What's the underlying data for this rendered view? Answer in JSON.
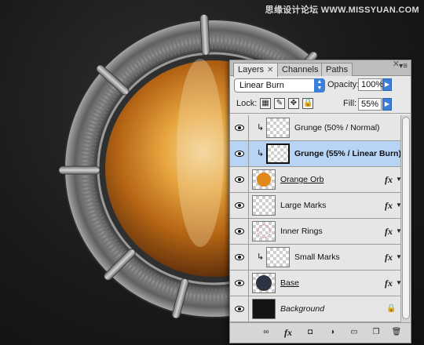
{
  "watermark": "思缘设计论坛 WWW.MISSYUAN.COM",
  "tabs": [
    {
      "label": "Layers",
      "active": true
    },
    {
      "label": "Channels",
      "active": false
    },
    {
      "label": "Paths",
      "active": false
    }
  ],
  "blend_mode": "Linear Burn",
  "opacity_label": "Opacity:",
  "opacity_value": "100%",
  "lock_label": "Lock:",
  "fill_label": "Fill:",
  "fill_value": "55%",
  "layers": [
    {
      "name": "Grunge (50% / Normal)",
      "clipped": true,
      "selected": false,
      "fx": false,
      "thumb": "transparent",
      "style": "normal"
    },
    {
      "name": "Grunge (55% / Linear Burn)",
      "clipped": true,
      "selected": true,
      "fx": false,
      "thumb": "transparent-selected",
      "style": "bold"
    },
    {
      "name": "Orange Orb",
      "clipped": false,
      "selected": false,
      "fx": true,
      "thumb": "orange-dot",
      "style": "underline"
    },
    {
      "name": "Large Marks",
      "clipped": false,
      "selected": false,
      "fx": true,
      "thumb": "transparent",
      "style": "normal"
    },
    {
      "name": "Inner Rings",
      "clipped": false,
      "selected": false,
      "fx": true,
      "thumb": "ring",
      "style": "normal"
    },
    {
      "name": "Small Marks",
      "clipped": true,
      "selected": false,
      "fx": true,
      "thumb": "transparent",
      "style": "normal"
    },
    {
      "name": "Base",
      "clipped": false,
      "selected": false,
      "fx": true,
      "thumb": "dark-disc",
      "style": "underline"
    },
    {
      "name": "Background",
      "clipped": false,
      "selected": false,
      "fx": false,
      "locked": true,
      "thumb": "dark",
      "style": "italic"
    }
  ],
  "colors": {
    "selection": "#b7d4f5",
    "accent": "#3b7fd9",
    "orb_orange": "#e0891a"
  }
}
